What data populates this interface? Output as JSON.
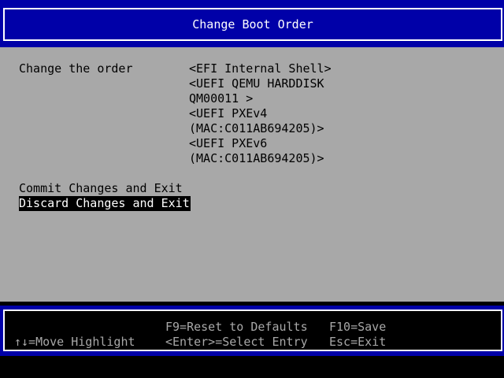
{
  "header": {
    "title": "Change Boot Order"
  },
  "form": {
    "label": "Change the order",
    "boot_lines": [
      "<EFI Internal Shell>",
      "<UEFI QEMU HARDDISK",
      "QM00011 >",
      "<UEFI PXEv4",
      "(MAC:C011AB694205)>",
      "<UEFI PXEv6",
      "(MAC:C011AB694205)>"
    ],
    "commit_label": "Commit Changes and Exit",
    "discard_label": "Discard Changes and Exit"
  },
  "footer": {
    "move_hint": "↑↓=Move Highlight",
    "reset_hint": "F9=Reset to Defaults",
    "select_hint": "<Enter>=Select Entry",
    "save_hint": "F10=Save",
    "exit_hint": "Esc=Exit"
  },
  "colors": {
    "frame_blue": "#0000a8",
    "panel_gray": "#a8a8a8",
    "highlight_bg": "#000000",
    "highlight_fg": "#ffffff"
  }
}
